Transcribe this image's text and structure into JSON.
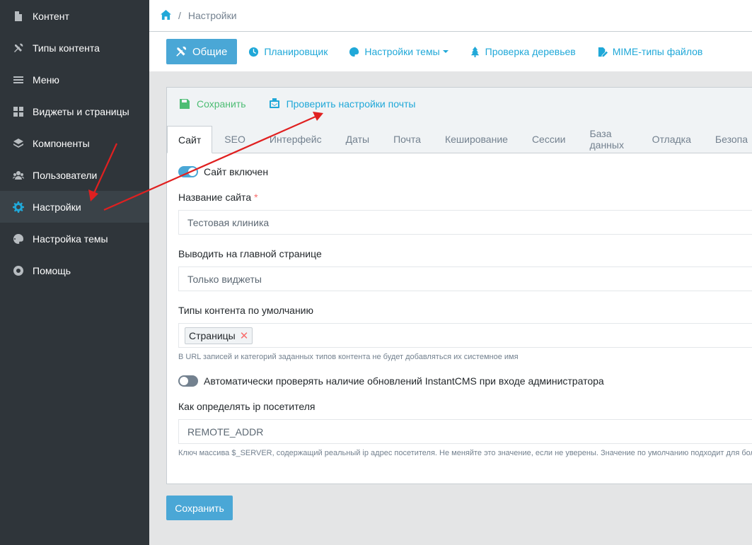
{
  "sidebar": {
    "items": [
      {
        "label": "Контент",
        "icon": "file-icon"
      },
      {
        "label": "Типы контента",
        "icon": "tools-icon"
      },
      {
        "label": "Меню",
        "icon": "bars-icon"
      },
      {
        "label": "Виджеты и страницы",
        "icon": "grid-icon"
      },
      {
        "label": "Компоненты",
        "icon": "layers-icon"
      },
      {
        "label": "Пользователи",
        "icon": "users-icon"
      },
      {
        "label": "Настройки",
        "icon": "gear-icon"
      },
      {
        "label": "Настройка темы",
        "icon": "palette-icon"
      },
      {
        "label": "Помощь",
        "icon": "lifebuoy-icon"
      }
    ],
    "active_index": 6
  },
  "breadcrumb": {
    "current": "Настройки"
  },
  "topnav": {
    "general": "Общие",
    "scheduler": "Планировщик",
    "theme_settings": "Настройки темы",
    "tree_check": "Проверка деревьев",
    "mime_types": "MIME-типы файлов"
  },
  "toolbar": {
    "save": "Сохранить",
    "check_mail": "Проверить настройки почты"
  },
  "tabs": [
    "Сайт",
    "SEO",
    "Интерфейс",
    "Даты",
    "Почта",
    "Кеширование",
    "Сессии",
    "База данных",
    "Отладка",
    "Безопа"
  ],
  "form": {
    "site_enabled": {
      "label": "Сайт включен",
      "value": true
    },
    "site_name": {
      "label": "Название сайта",
      "required": "*",
      "value": "Тестовая клиника"
    },
    "frontpage": {
      "label": "Выводить на главной странице",
      "value": "Только виджеты"
    },
    "default_ctypes": {
      "label": "Типы контента по умолчанию",
      "chip": "Страницы",
      "chip_remove": "✕",
      "hint": "В URL записей и категорий заданных типов контента не будет добавляться их системное имя"
    },
    "auto_update": {
      "label": "Автоматически проверять наличие обновлений InstantCMS при входе администратора",
      "value": false
    },
    "ip_detect": {
      "label": "Как определять ip посетителя",
      "value": "REMOTE_ADDR",
      "hint": "Ключ массива $_SERVER, содержащий реальный ip адрес посетителя. Не меняйте это значение, если не уверены. Значение по умолчанию подходит для бол"
    }
  },
  "save_button": "Сохранить",
  "colors": {
    "accent": "#4aa7d6",
    "sidebar": "#2f353a",
    "annotation": "#e02020",
    "success": "#4dbd74"
  }
}
